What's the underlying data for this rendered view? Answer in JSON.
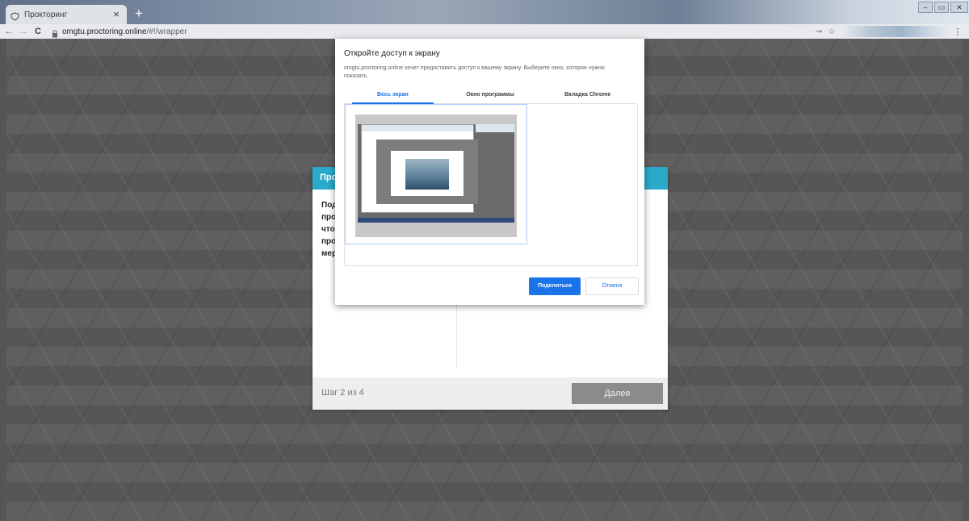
{
  "browser": {
    "tab_title": "Прокторинг",
    "url_host": "omgtu.proctoring.online",
    "url_path": "/#!/wrapper",
    "tab_close": "×",
    "new_tab": "+",
    "win_minimize": "–",
    "win_restore": "▭",
    "win_close": "✕",
    "back": "←",
    "forward": "→",
    "reload": "C",
    "menu": "⋮",
    "key": "⊸",
    "star": "☆"
  },
  "wizard": {
    "title_fragment": "Про",
    "text_lines": [
      "Под",
      "про",
      "что",
      "про",
      "мер"
    ],
    "step_label": "Шаг 2 из 4",
    "next_label": "Далее"
  },
  "share_dialog": {
    "title": "Откройте доступ к экрану",
    "description_lines": [
      "omgtu.proctoring.online хочет предоставить доступ к вашему экрану. Выберите окно, которое нужно",
      "показать."
    ],
    "tabs": [
      {
        "label": "Весь экран",
        "active": true
      },
      {
        "label": "Окно программы",
        "active": false
      },
      {
        "label": "Вкладка Chrome",
        "active": false
      }
    ],
    "share_label": "Поделиться",
    "cancel_label": "Отмена"
  },
  "colors": {
    "accent": "#2aa9c9",
    "share_blue": "#1a73e8",
    "next_gray": "#8b8b8b"
  }
}
